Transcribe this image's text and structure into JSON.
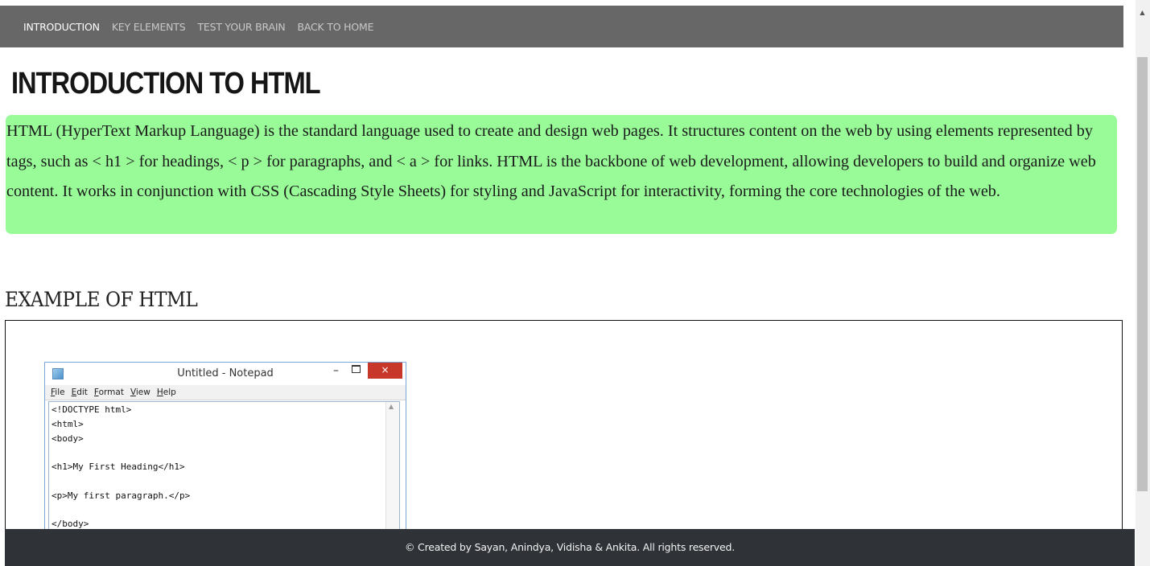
{
  "nav": {
    "items": [
      "INTRODUCTION",
      "KEY ELEMENTS",
      "TEST YOUR BRAIN",
      "BACK TO HOME"
    ]
  },
  "page": {
    "title": "INTRODUCTION TO HTML",
    "intro": "HTML (HyperText Markup Language) is the standard language used to create and design web pages. It structures content on the web by using elements represented by tags, such as < h1 > for headings, < p > for paragraphs, and < a > for links. HTML is the backbone of web development, allowing developers to build and organize web content. It works in conjunction with CSS (Cascading Style Sheets) for styling and JavaScript for interactivity, forming the core technologies of the web.",
    "example_heading": "EXAMPLE OF HTML"
  },
  "notepad": {
    "title": "Untitled - Notepad",
    "close_glyph": "×",
    "min_glyph": "–",
    "menu": [
      "File",
      "Edit",
      "Format",
      "View",
      "Help"
    ],
    "code": "<!DOCTYPE html>\n<html>\n<body>\n\n<h1>My First Heading</h1>\n\n<p>My first paragraph.</p>\n\n</body>"
  },
  "footer": {
    "text": "© Created by Sayan, Anindya, Vidisha & Ankita. All rights reserved."
  },
  "colors": {
    "navbar": "#666766",
    "intro_bg": "#98fb98",
    "footer_bg": "#2f3237"
  }
}
